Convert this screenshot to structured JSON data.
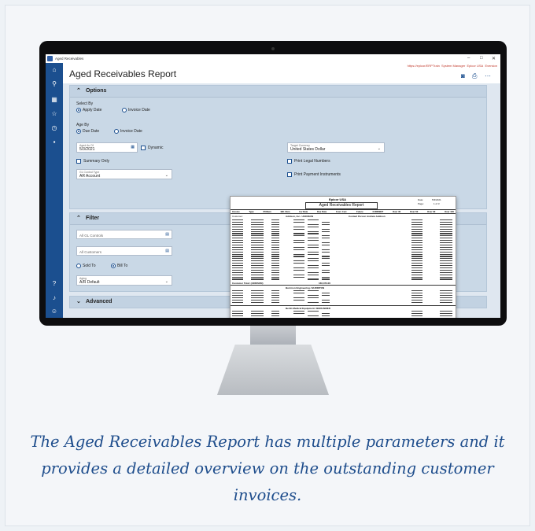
{
  "app": {
    "window_title": "Aged Receivables",
    "url": "https://epicor/ERPTrain",
    "user_links": [
      "System Manager",
      "Epicor USA",
      "Eversion"
    ]
  },
  "page": {
    "title": "Aged Receivables Report"
  },
  "options": {
    "header": "Options",
    "select_by_label": "Select By",
    "apply_date": "Apply Date",
    "invoice_date": "Invoice Date",
    "age_by_label": "Age By",
    "due_date": "Due Date",
    "age_invoice_date": "Invoice Date",
    "aged_as_of_label": "Aged As Of",
    "aged_as_of_value": "5/3/2021",
    "dynamic": "Dynamic",
    "summary_only": "Summary Only",
    "gl_control_type_label": "GL Control Type",
    "gl_control_type_value": "AR Account",
    "target_currency_label": "Target Currency",
    "target_currency_value": "United States Dollar",
    "print_legal_numbers": "Print Legal Numbers",
    "print_payment_instruments": "Print Payment Instruments"
  },
  "filter": {
    "header": "Filter",
    "all_gl_controls": "All GL Controls",
    "all_customers": "All Customers",
    "sold_to": "Sold To",
    "bill_to": "Bill To",
    "aging_label": "Aging",
    "aging_value": "A/R Default"
  },
  "advanced": {
    "header": "Advanced"
  },
  "report": {
    "company": "Epicor USA",
    "title": "Aged Receivables Report",
    "date_label": "Date:",
    "date_value": "5/3/2021",
    "page_label": "Page:",
    "page_value": "1 of 3",
    "columns": [
      "Invoice",
      "Type",
      "PONum",
      "Bill. Rem",
      "Inv Date",
      "Due Date",
      "Cust. Curr.",
      "Future",
      "CURRENT",
      "Over 30",
      "Over 60",
      "Over 90",
      "Over 120"
    ],
    "customer_label": "Customer:",
    "customer_1": "Addison, Inc. / ADDISON",
    "contact_1": "Contact Person Andrew Addison",
    "customer_2": "Burrmon Engineering / BURRITON",
    "customer_3": "Berlin Medical Equipment / BERLINMED",
    "customer_total_label": "Customer Total: (ADDISON)",
    "customer_total_value": "166,373.00"
  },
  "caption": "The Aged Receivables Report has multiple parameters and it provides a detailed overview on the outstanding customer invoices.",
  "colors": {
    "rail": "#1b4f8f",
    "panel": "#c9d8e6",
    "caption": "#1e4d8c"
  }
}
